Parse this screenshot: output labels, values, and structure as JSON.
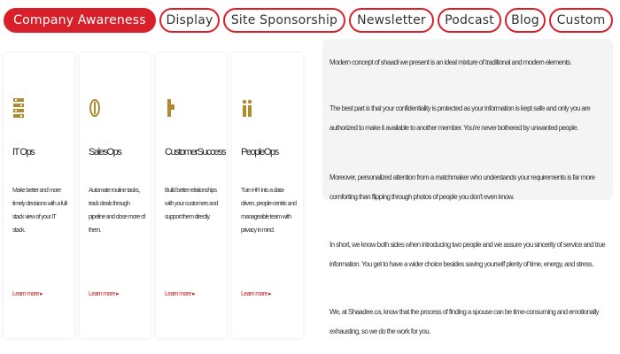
{
  "tabs": [
    {
      "label": "Company Awareness",
      "active": true
    },
    {
      "label": "Display",
      "active": false
    },
    {
      "label": "Site Sponsorship",
      "active": false
    },
    {
      "label": "Newsletter",
      "active": false
    },
    {
      "label": "Podcast",
      "active": false
    },
    {
      "label": "Blog",
      "active": false
    },
    {
      "label": "Custom",
      "active": false
    }
  ],
  "cards": [
    {
      "icon": "building-icon",
      "title": "IT Ops",
      "description": "Make better and more timely decisions with a full-stack view of your IT stack.",
      "link": "Learn more ▸"
    },
    {
      "icon": "dollar-icon",
      "title": "SalesOps",
      "description": "Automate routine tasks, track deals through pipeline and close more of them.",
      "link": "Learn more ▸"
    },
    {
      "icon": "customer-icon",
      "title": "CustomerSuccess",
      "description": "Build better relationships with your customers and support them directly.",
      "link": "Learn more ▸"
    },
    {
      "icon": "people-icon",
      "title": "PeopleOps",
      "description": "Turn HR into a data-driven, people-centric and manageable team with privacy in mind.",
      "link": "Learn more ▸"
    }
  ],
  "paragraphs": [
    "Modern concept of shaadi we present is an ideal mixture of traditional and modern elements.",
    "The best part is that your confidentiality is protected as your information is kept safe and only you are authorized to make it available to another member. You're never bothered by unwanted people.",
    "Moreover, personalized attention from a matchmaker who understands your requirements is far more comforting than flipping through photos of people you don't even know.",
    "In short, we know both sides when introducing two people and we assure you sincerity of service and true information. You get to have a wider choice besides saving yourself plenty of time, energy, and stress.",
    "We, at Shaadee.ca, know that the process of finding a spouse can be time-consuming and emotionally exhausting, so we do the work for you."
  ],
  "colors": {
    "accent": "#d8202a",
    "icon_gold": "#b08a2e",
    "link_red": "#c62828",
    "panel_bg": "#f4f4f4"
  }
}
